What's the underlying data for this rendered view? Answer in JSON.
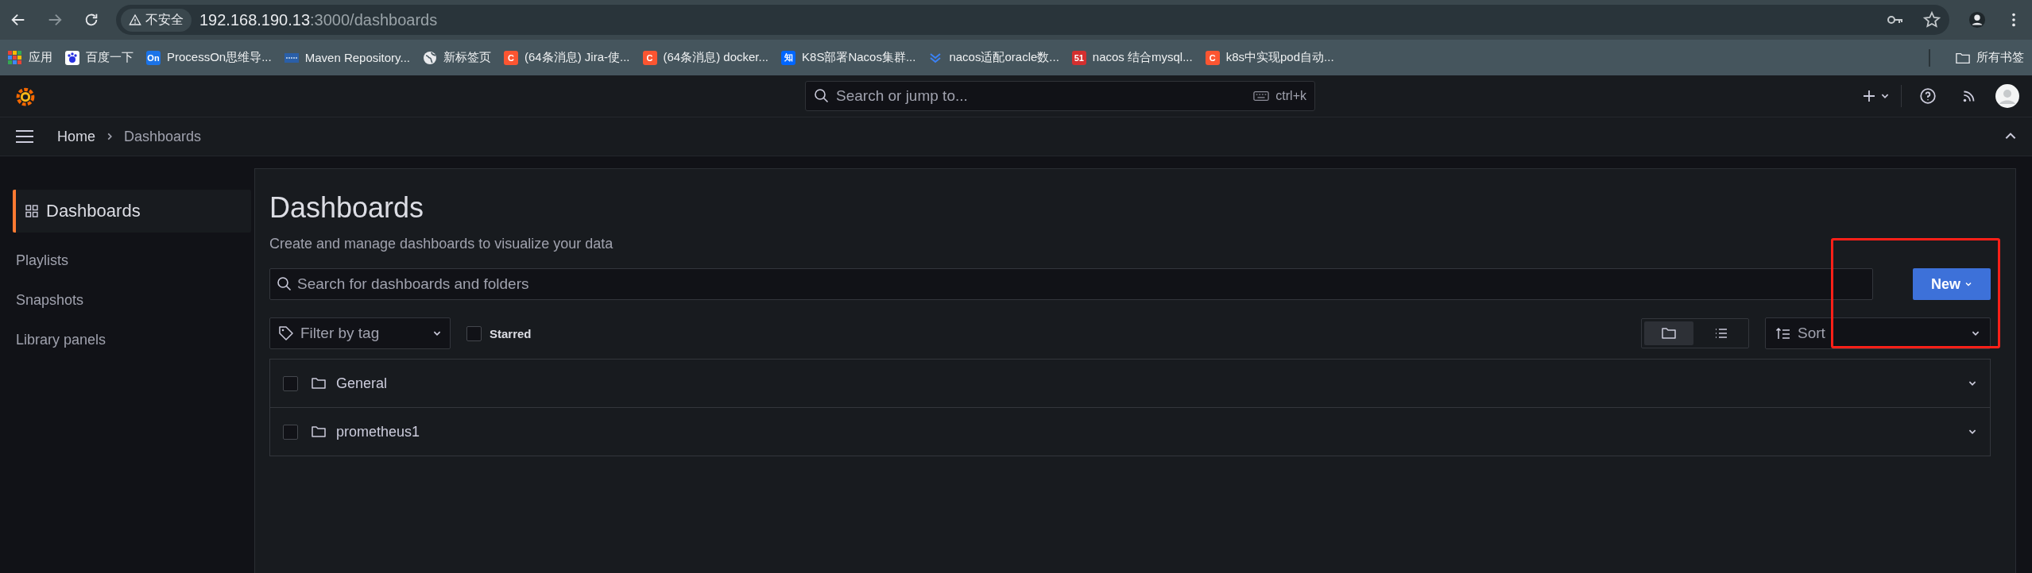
{
  "browser": {
    "security": "不安全",
    "url_host": "192.168.190.13",
    "url_rest": ":3000/dashboards",
    "all_bookmarks": "所有书签",
    "bookmarks": [
      {
        "kind": "grid",
        "label": "应用"
      },
      {
        "kind": "paw",
        "label": "百度一下",
        "color": "#2932e1"
      },
      {
        "kind": "tile",
        "icon_text": "On",
        "label": "ProcessOn思维导...",
        "color": "#1a73e8"
      },
      {
        "kind": "bars",
        "label": "Maven Repository...",
        "color": "#2a5fa8"
      },
      {
        "kind": "globe",
        "label": "新标签页"
      },
      {
        "kind": "tile",
        "icon_text": "C",
        "label": "(64条消息) Jira-使...",
        "color": "#fc5531"
      },
      {
        "kind": "tile",
        "icon_text": "C",
        "label": "(64条消息) docker...",
        "color": "#fc5531"
      },
      {
        "kind": "tile",
        "icon_text": "知",
        "label": "K8S部署Nacos集群...",
        "color": "#0066ff"
      },
      {
        "kind": "chevrons",
        "label": "nacos适配oracle数...",
        "color": "#3b82f6"
      },
      {
        "kind": "tile",
        "icon_text": "51",
        "label": "nacos 结合mysql...",
        "color": "#d32f2f"
      },
      {
        "kind": "tile",
        "icon_text": "C",
        "label": "k8s中实现pod自动...",
        "color": "#fc5531"
      }
    ]
  },
  "topbar": {
    "search_placeholder": "Search or jump to...",
    "shortcut": "ctrl+k"
  },
  "breadcrumb": [
    "Home",
    "Dashboards"
  ],
  "sidebar": {
    "items": [
      {
        "label": "Dashboards",
        "selected": true
      },
      {
        "label": "Playlists",
        "selected": false
      },
      {
        "label": "Snapshots",
        "selected": false
      },
      {
        "label": "Library panels",
        "selected": false
      }
    ]
  },
  "page": {
    "title": "Dashboards",
    "subtitle": "Create and manage dashboards to visualize your data",
    "search_placeholder": "Search for dashboards and folders",
    "new_button": "New",
    "highlighted": true,
    "filter_placeholder": "Filter by tag",
    "starred": {
      "label": "Starred",
      "checked": false
    },
    "views": [
      {
        "kind": "folder",
        "selected": true
      },
      {
        "kind": "list",
        "selected": false
      }
    ],
    "sort_placeholder": "Sort",
    "folders": [
      {
        "name": "General",
        "checked": false
      },
      {
        "name": "prometheus1",
        "checked": false
      }
    ]
  }
}
